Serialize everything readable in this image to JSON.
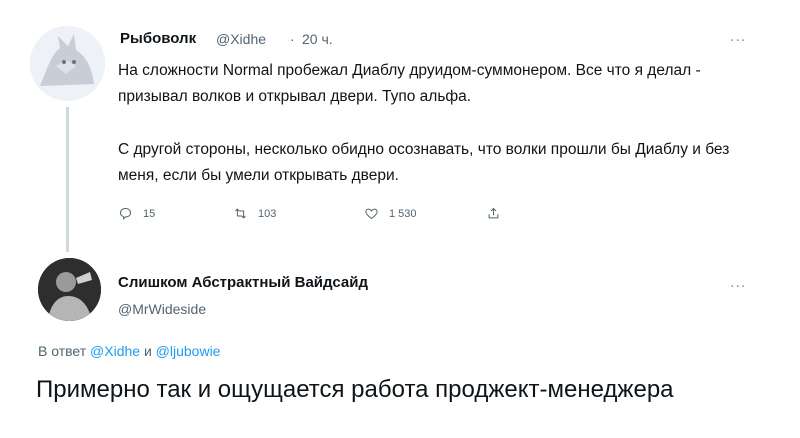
{
  "tweet1": {
    "display_name": "Рыбоволк",
    "handle": "@Xidhe",
    "separator": "·",
    "time": "20 ч.",
    "more": "...",
    "paragraph1": "На сложности Normal пробежал Диаблу друидом-суммонером. Все что я делал - призывал волков и открывал двери. Тупо альфа.",
    "paragraph2": "С другой стороны, несколько обидно осознавать, что волки прошли бы Диаблу и без меня, если бы умели открывать двери.",
    "replies": "15",
    "retweets": "103",
    "likes": "1 530",
    "icons": [
      "reply-icon",
      "retweet-icon",
      "like-icon",
      "share-icon"
    ]
  },
  "tweet2": {
    "display_name": "Слишком Абстрактный Вайдсайд",
    "handle": "@MrWideside",
    "more": "...",
    "replying_prefix": "В ответ",
    "replying_user1": "@Xidhe",
    "replying_and": "и",
    "replying_user2": "@ljubowie",
    "text": "Примерно так и ощущается работа проджект-менеджера"
  },
  "colors": {
    "text": "#0f1419",
    "secondary": "#536471",
    "link": "#1d9bf0",
    "thread_line": "#cfd9de"
  }
}
